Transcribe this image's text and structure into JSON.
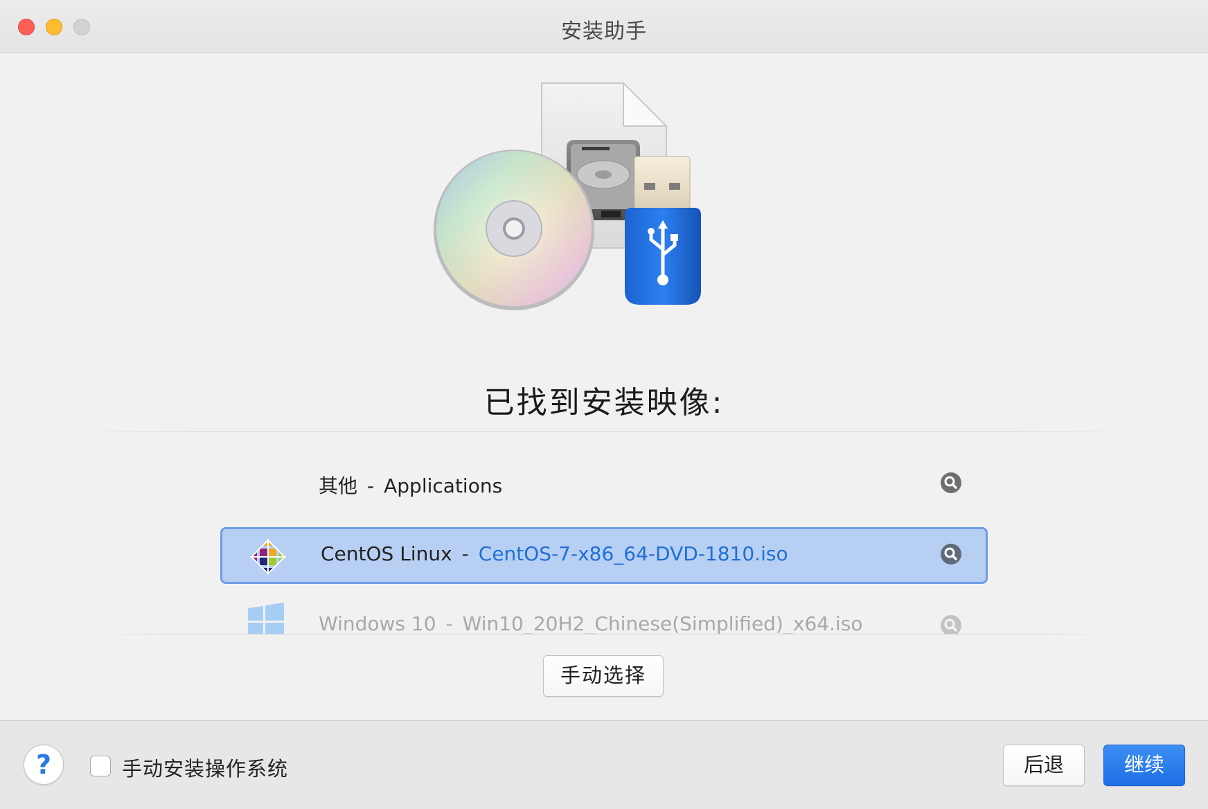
{
  "window": {
    "title": "安装助手"
  },
  "heading": "已找到安装映像:",
  "images": [
    {
      "os": "其他",
      "separator": "-",
      "file": "Applications",
      "icon": "none",
      "selected": false,
      "faded": false
    },
    {
      "os": "CentOS Linux",
      "separator": "-",
      "file": "CentOS-7-x86_64-DVD-1810.iso",
      "icon": "centos-logo-icon",
      "selected": true,
      "faded": false
    },
    {
      "os": "Windows 10",
      "separator": "-",
      "file": "Win10_20H2_Chinese(Simplified)_x64.iso",
      "icon": "windows-logo-icon",
      "selected": false,
      "faded": true
    }
  ],
  "buttons": {
    "manual_select": "手动选择",
    "back": "后退",
    "continue": "继续",
    "help": "?"
  },
  "checkbox": {
    "label": "手动安装操作系统",
    "checked": false
  },
  "colors": {
    "selection_fill": "#b7cff2",
    "selection_border": "#6e9de6",
    "file_link": "#1f6fd6",
    "primary_button": "#1d6fe6",
    "usb_blue": "#1a64d0"
  }
}
